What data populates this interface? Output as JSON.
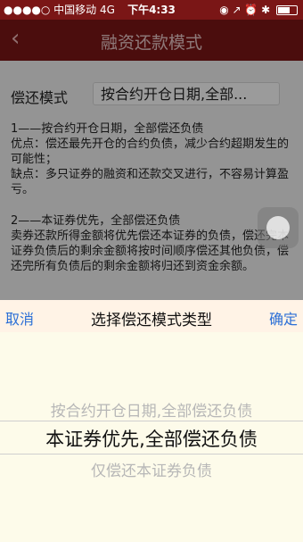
{
  "status": {
    "left": "●●●●○ 中国移动  4G",
    "time": "下午4:33",
    "right": "◉ ↗ ⏰ ✱"
  },
  "nav": {
    "back_icon": "‹",
    "title": "融资还款模式"
  },
  "form": {
    "label": "偿还模式",
    "selected": "按合约开仓日期,全部..."
  },
  "descriptions": [
    "1——按合约开仓日期，全部偿还负债",
    "优点：偿还最先开仓的合约负债，减少合约超期发生的可能性；",
    "缺点：多只证券的融资和还款交叉进行，不容易计算盈亏。",
    "2——本证券优先，全部偿还负债",
    "卖券还款所得金额将优先偿还本证券的负债，偿还完本证券负债后的剩余金额将按时间顺序偿还其他负债，偿还完所有负债后的剩余金额将归还到资金余额。"
  ],
  "picker": {
    "cancel": "取消",
    "title": "选择偿还模式类型",
    "confirm": "确定",
    "options": [
      "按合约开仓日期,全部偿还负债",
      "本证券优先,全部偿还负债",
      "仅偿还本证券负债"
    ],
    "selected_index": 1
  },
  "colors": {
    "nav": "#7a1616",
    "link": "#2b6fd6",
    "picker_bg": "#fdfbea",
    "picker_header_bg": "#fff3e6"
  }
}
